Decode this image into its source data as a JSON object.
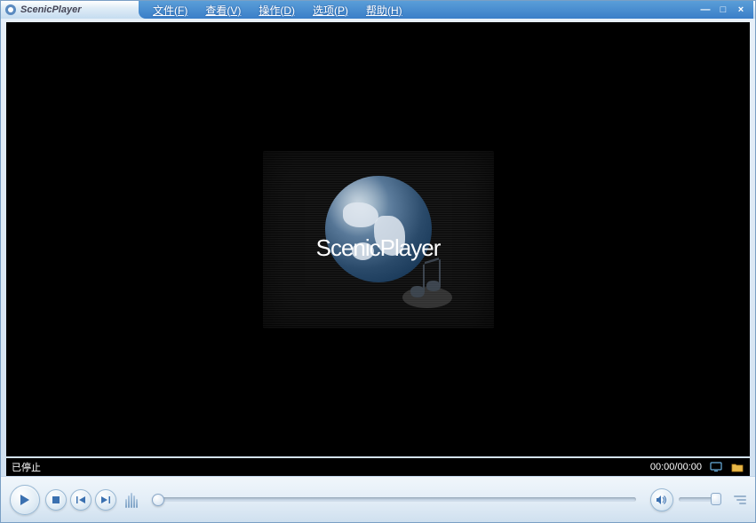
{
  "app": {
    "title": "ScenicPlayer",
    "splash_text": "ScenicPlayer"
  },
  "menu": {
    "file": "文件(F)",
    "view": "查看(V)",
    "action": "操作(D)",
    "options": "选项(P)",
    "help": "帮助(H)"
  },
  "window_controls": {
    "minimize": "—",
    "maximize": "□",
    "close": "×"
  },
  "status": {
    "state": "已停止",
    "time": "00:00/00:00"
  },
  "controls": {
    "play": "play",
    "stop": "stop",
    "prev": "previous",
    "next": "next",
    "volume": "volume"
  },
  "icons": {
    "monitor": "monitor",
    "folder": "folder"
  }
}
